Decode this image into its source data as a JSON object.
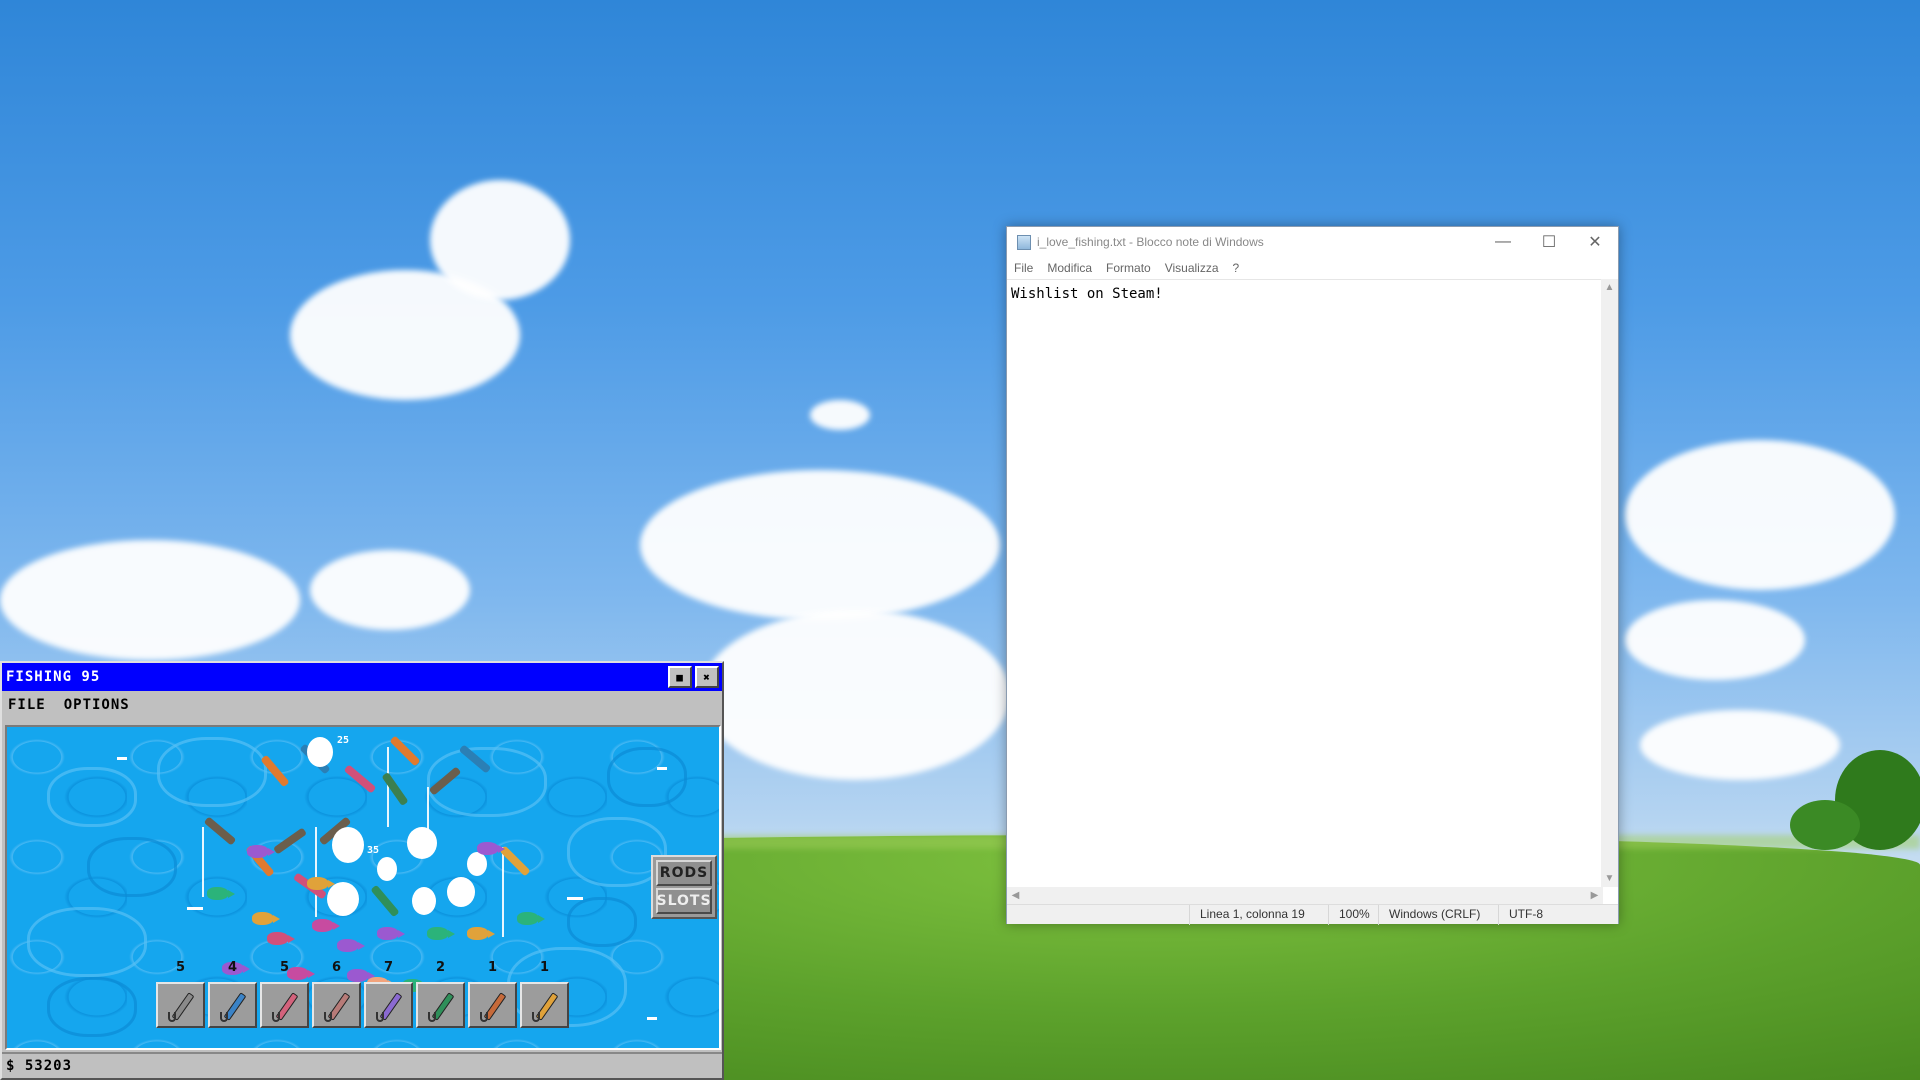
{
  "notepad": {
    "title": "i_love_fishing.txt - Blocco note di Windows",
    "menu": [
      "File",
      "Modifica",
      "Formato",
      "Visualizza",
      "?"
    ],
    "content": "Wishlist on Steam!",
    "status": {
      "position": "Linea 1, colonna 19",
      "zoom": "100%",
      "line_ending": "Windows (CRLF)",
      "encoding": "UTF-8"
    }
  },
  "fishing": {
    "title": "FISHING 95",
    "menu": [
      "FILE",
      "OPTIONS"
    ],
    "buttons": {
      "rods": "RODS",
      "slots": "SLOTS"
    },
    "water_labels": [
      "25",
      "35"
    ],
    "rods": [
      {
        "count": "5",
        "color": "#8a8a8a"
      },
      {
        "count": "4",
        "color": "#3a83c7"
      },
      {
        "count": "5",
        "color": "#d3627c"
      },
      {
        "count": "6",
        "color": "#b77b78"
      },
      {
        "count": "7",
        "color": "#8b6ad1"
      },
      {
        "count": "2",
        "color": "#2f8f5a"
      },
      {
        "count": "1",
        "color": "#c66a3a"
      },
      {
        "count": "1",
        "color": "#e0a23a"
      }
    ],
    "money": "$ 53203"
  }
}
